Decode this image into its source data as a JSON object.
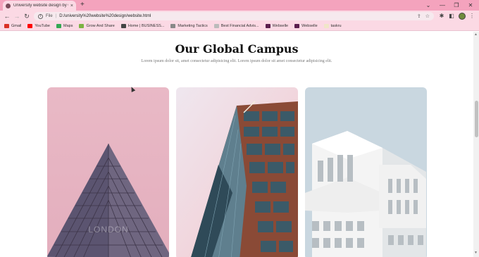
{
  "browser": {
    "tab_title": "University website design by Om",
    "tab_close": "×",
    "new_tab": "+",
    "controls": {
      "chevron": "⌄",
      "minimize": "—",
      "restore": "❐",
      "close": "✕"
    },
    "address": {
      "scheme_label": "File",
      "url": "D:/university%20website%20design/website.html"
    },
    "nav": {
      "back": "←",
      "forward": "→",
      "reload": "↻"
    },
    "toolbar_icons": [
      "share-icon",
      "star-icon",
      "extensions-icon",
      "sidebar-icon",
      "profile-avatar",
      "menu-icon"
    ]
  },
  "bookmarks": [
    {
      "label": "Gmail",
      "icon": "gmail-icon",
      "color": "#d93025"
    },
    {
      "label": "YouTube",
      "icon": "youtube-icon",
      "color": "#ff0000"
    },
    {
      "label": "Maps",
      "icon": "maps-icon",
      "color": "#34a853"
    },
    {
      "label": "Grow And Share",
      "icon": "globe-icon",
      "color": "#7cb342"
    },
    {
      "label": "Home | BUSINESS...",
      "icon": "business-icon",
      "color": "#444444"
    },
    {
      "label": "Marketing Tactics",
      "icon": "tactics-icon",
      "color": "#888888"
    },
    {
      "label": "Best Financial Advis...",
      "icon": "finance-icon",
      "color": "#bbbbbb"
    },
    {
      "label": "Webselle",
      "icon": "webselle-icon",
      "color": "#5a1e4e"
    },
    {
      "label": "Webselle",
      "icon": "webselle-icon",
      "color": "#5a1e4e"
    },
    {
      "label": "taskru",
      "icon": "taskru-icon",
      "color": "#f0e6c8"
    }
  ],
  "page": {
    "title": "Our Global Campus",
    "subtitle": "Lorem ipsum dolor sit, amet consectetur adipisicing elit. Lorem ipsum dolor sit amet consectetur adipisicing elit.",
    "cards": [
      {
        "name": "campus-card-london",
        "watermark": "LONDON"
      },
      {
        "name": "campus-card-tower"
      },
      {
        "name": "campus-card-white-building"
      }
    ]
  },
  "colors": {
    "chrome": "#f4a3bd",
    "chrome_light": "#fbd9e4"
  }
}
